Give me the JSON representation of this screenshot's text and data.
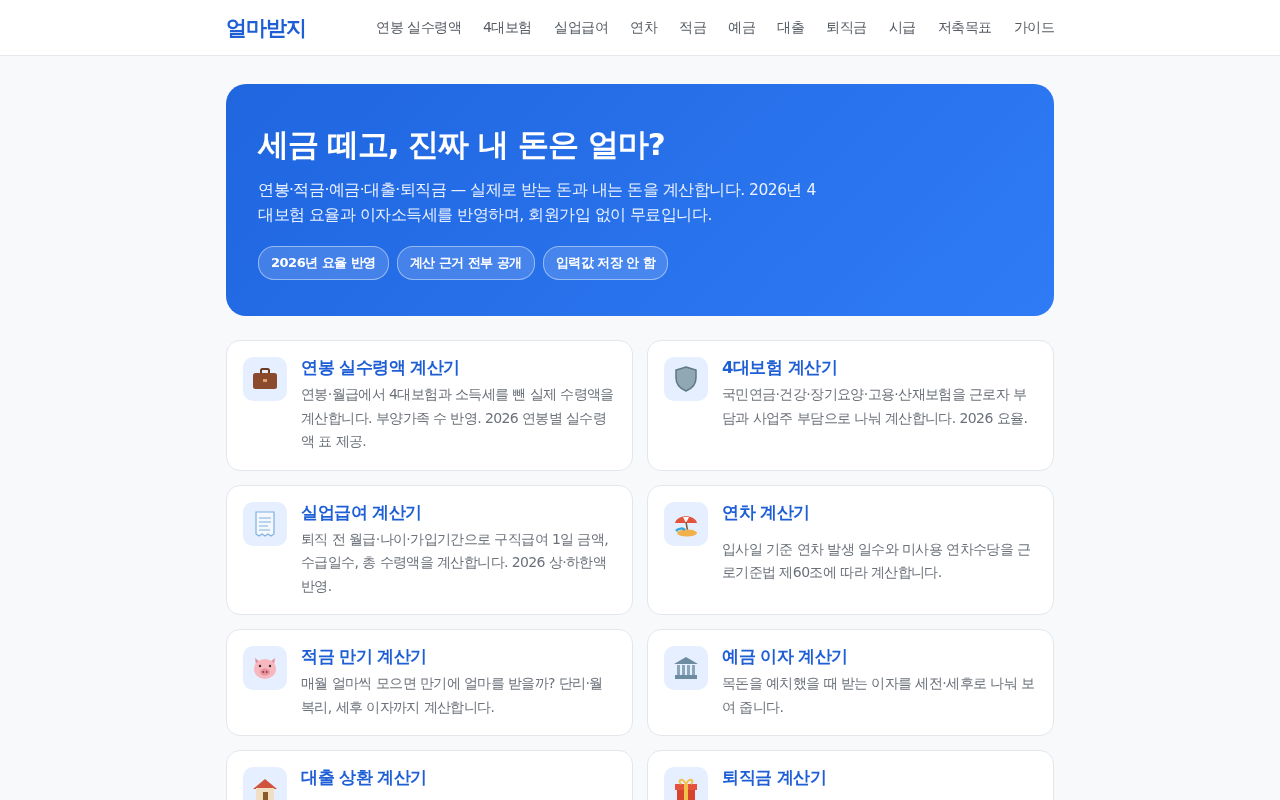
{
  "header": {
    "logo": "얼마받지",
    "nav": [
      {
        "label": "연봉 실수령액"
      },
      {
        "label": "4대보험"
      },
      {
        "label": "실업급여"
      },
      {
        "label": "연차"
      },
      {
        "label": "적금"
      },
      {
        "label": "예금"
      },
      {
        "label": "대출"
      },
      {
        "label": "퇴직금"
      },
      {
        "label": "시급"
      },
      {
        "label": "저축목표"
      },
      {
        "label": "가이드"
      }
    ]
  },
  "hero": {
    "title": "세금 떼고, 진짜 내 돈은 얼마?",
    "description": "연봉·적금·예금·대출·퇴직금 — 실제로 받는 돈과 내는 돈을 계산합니다. 2026년 4대보험 요율과 이자소득세를 반영하며, 회원가입 없이 무료입니다.",
    "badges": [
      "2026년 요율 반영",
      "계산 근거 전부 공개",
      "입력값 저장 안 함"
    ]
  },
  "cards": [
    {
      "kind": "briefcase",
      "title": "연봉 실수령액 계산기",
      "description": "연봉·월급에서 4대보험과 소득세를 뺀 실제 수령액을 계산합니다. 부양가족 수 반영. 2026 연봉별 실수령액 표 제공."
    },
    {
      "kind": "shield",
      "title": "4대보험 계산기",
      "description": "국민연금·건강·장기요양·고용·산재보험을 근로자 부담과 사업주 부담으로 나눠 계산합니다. 2026 요율."
    },
    {
      "kind": "receipt",
      "title": "실업급여 계산기",
      "description": "퇴직 전 월급·나이·가입기간으로 구직급여 1일 금액, 수급일수, 총 수령액을 계산합니다. 2026 상·하한액 반영."
    },
    {
      "kind": "umbrella",
      "title": "연차 계산기",
      "description": "입사일 기준 연차 발생 일수와 미사용 연차수당을 근로기준법 제60조에 따라 계산합니다."
    },
    {
      "kind": "pig",
      "title": "적금 만기 계산기",
      "description": "매월 얼마씩 모으면 만기에 얼마를 받을까? 단리·월복리, 세후 이자까지 계산합니다."
    },
    {
      "kind": "bank",
      "title": "예금 이자 계산기",
      "description": "목돈을 예치했을 때 받는 이자를 세전·세후로 나눠 보여 줍니다."
    },
    {
      "kind": "house",
      "title": "대출 상환 계산기"
    },
    {
      "kind": "gift",
      "title": "퇴직금 계산기"
    }
  ]
}
